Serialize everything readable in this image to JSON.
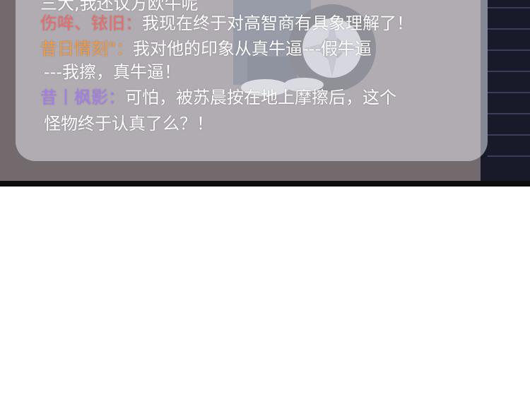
{
  "comments": [
    {
      "user": "",
      "user_color": "",
      "text": "三大,我还议方欧牛呢"
    },
    {
      "user": "伤哞、铱旧：",
      "user_color": "#f06a6a",
      "text": "我现在终于对高智商有具象理解了！"
    },
    {
      "user": "昔日情刻\"：",
      "user_color": "#f29a45",
      "text": "我对他的印象从真牛逼---假牛逼"
    },
    {
      "user": "",
      "user_color": "",
      "text": "---我擦，真牛逼！"
    },
    {
      "user": "昔丨枫影：",
      "user_color": "#a77bf0",
      "text": "可怕，被苏晨按在地上摩擦后，这个"
    },
    {
      "user": "",
      "user_color": "",
      "text": "怪物终于认真了么？！"
    }
  ]
}
